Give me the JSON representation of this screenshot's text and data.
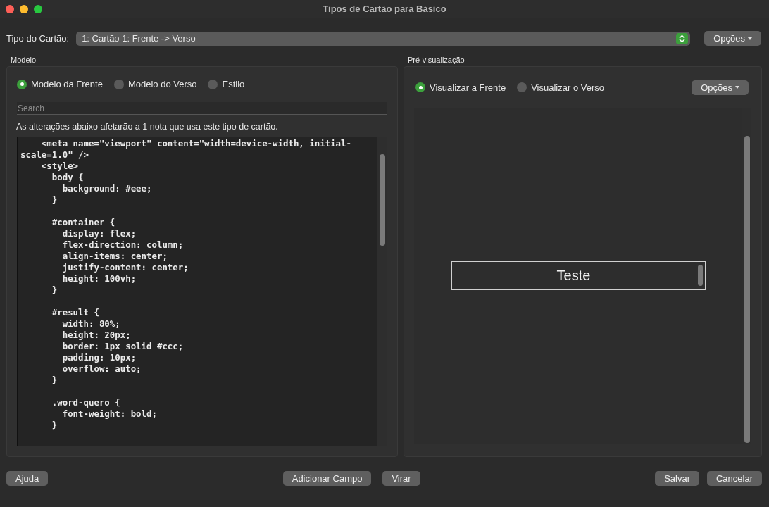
{
  "window": {
    "title": "Tipos de Cartão para Básico"
  },
  "card_type": {
    "label": "Tipo do Cartão:",
    "value": "1: Cartão 1: Frente -> Verso",
    "options_button": "Opções"
  },
  "template": {
    "title": "Modelo",
    "tabs": [
      {
        "label": "Modelo da Frente",
        "selected": true
      },
      {
        "label": "Modelo do Verso",
        "selected": false
      },
      {
        "label": "Estilo",
        "selected": false
      }
    ],
    "search": {
      "placeholder": "Search"
    },
    "notice": "As alterações abaixo afetarão a 1 nota que usa este tipo de cartão.",
    "code": "    <meta name=\"viewport\" content=\"width=device-width, initial-\nscale=1.0\" />\n    <style>\n      body {\n        background: #eee;\n      }\n\n      #container {\n        display: flex;\n        flex-direction: column;\n        align-items: center;\n        justify-content: center;\n        height: 100vh;\n      }\n\n      #result {\n        width: 80%;\n        height: 20px;\n        border: 1px solid #ccc;\n        padding: 10px;\n        overflow: auto;\n      }\n\n      .word-quero {\n        font-weight: bold;\n      }"
  },
  "preview": {
    "title": "Pré-visualização",
    "tabs": [
      {
        "label": "Visualizar a Frente",
        "selected": true
      },
      {
        "label": "Visualizar o Verso",
        "selected": false
      }
    ],
    "options_button": "Opções",
    "result_text": "Teste"
  },
  "buttons": {
    "left": [
      "Ajuda"
    ],
    "center": [
      "Adicionar Campo",
      "Virar"
    ],
    "right": [
      "Salvar",
      "Cancelar"
    ]
  }
}
